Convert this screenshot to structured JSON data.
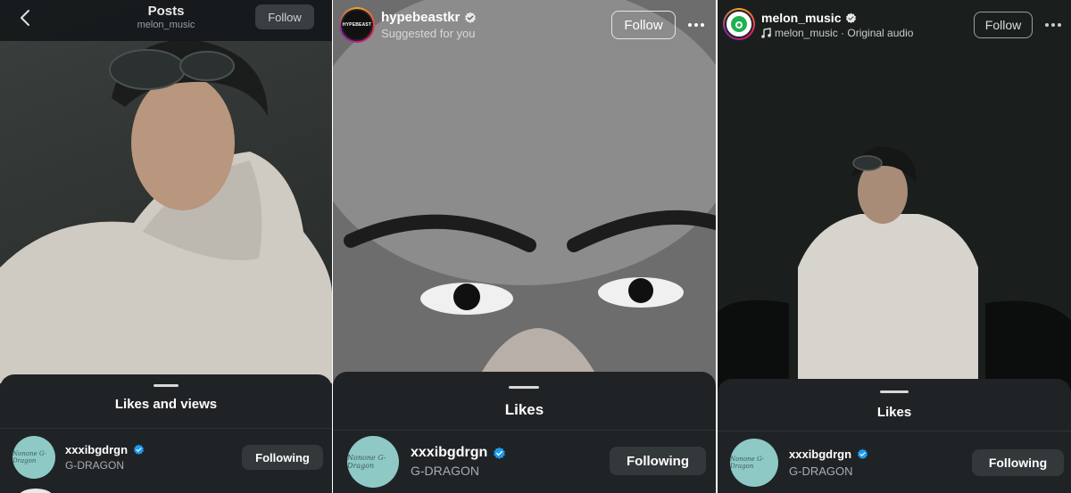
{
  "panel1": {
    "header": {
      "title": "Posts",
      "subtitle": "melon_music",
      "follow_label": "Follow"
    },
    "sheet": {
      "title": "Likes and views",
      "row": {
        "username": "xxxibgdrgn",
        "display_name": "G-DRAGON",
        "button_label": "Following",
        "avatar_text": "Nonone G-Dragon"
      }
    }
  },
  "panel2": {
    "header": {
      "username": "hypebeastkr",
      "subtitle": "Suggested for you",
      "follow_label": "Follow",
      "avatar_text": "HYPEBEAST"
    },
    "sheet": {
      "title": "Likes",
      "row": {
        "username": "xxxibgdrgn",
        "display_name": "G-DRAGON",
        "button_label": "Following",
        "avatar_text": "Nonone G-Dragon"
      }
    }
  },
  "panel3": {
    "header": {
      "username": "melon_music",
      "audio": "melon_music · Original audio",
      "follow_label": "Follow"
    },
    "sheet": {
      "title": "Likes",
      "row": {
        "username": "xxxibgdrgn",
        "display_name": "G-DRAGON",
        "button_label": "Following",
        "avatar_text": "Nonone G-Dragon"
      }
    }
  },
  "colors": {
    "verified": "#1d9bf0",
    "sheet": "#1f2325",
    "avatar_teal": "#8ec9c6",
    "melon_green": "#1fb050"
  }
}
